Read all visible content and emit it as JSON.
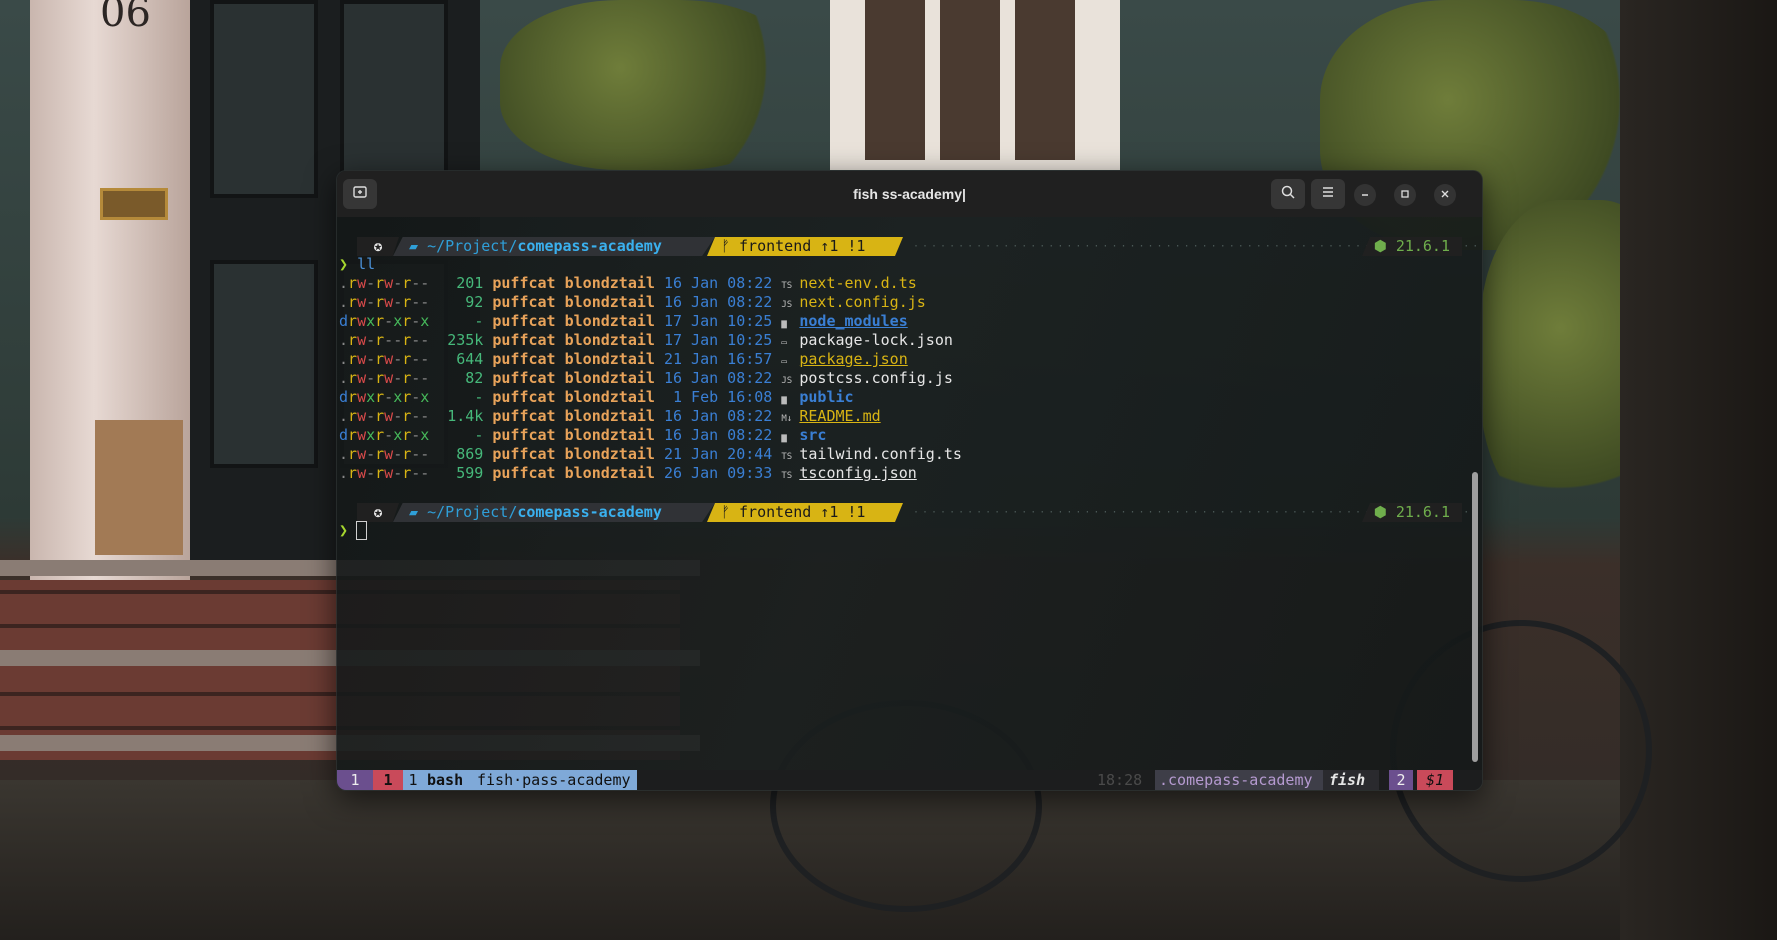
{
  "window": {
    "title": "fish ss-academy|"
  },
  "wallpaper": {
    "house_number": "06"
  },
  "prompt": {
    "path_prefix": "~/Project/",
    "path_dir": "comepass-academy",
    "git": "ᚠ frontend ↑1 !1",
    "node": "⬢ 21.6.1",
    "caret": "❯",
    "command": "ll"
  },
  "listing": [
    {
      "perm": ".rw-rw-r--",
      "size": "201",
      "owner": "puffcat",
      "group": "blondztail",
      "date": "16 Jan 08:22",
      "icon": "TS",
      "name": "next-env.d.ts",
      "style": "yellow"
    },
    {
      "perm": ".rw-rw-r--",
      "size": "92",
      "owner": "puffcat",
      "group": "blondztail",
      "date": "16 Jan 08:22",
      "icon": "JS",
      "name": "next.config.js",
      "style": "yellow"
    },
    {
      "perm": "drwxr-xr-x",
      "size": "-",
      "owner": "puffcat",
      "group": "blondztail",
      "date": "17 Jan 10:25",
      "icon": "▆",
      "name": "node_modules",
      "style": "dir-u"
    },
    {
      "perm": ".rw-r--r--",
      "size": "235k",
      "owner": "puffcat",
      "group": "blondztail",
      "date": "17 Jan 10:25",
      "icon": "▭",
      "name": "package-lock.json",
      "style": "white"
    },
    {
      "perm": ".rw-rw-r--",
      "size": "644",
      "owner": "puffcat",
      "group": "blondztail",
      "date": "21 Jan 16:57",
      "icon": "▭",
      "name": "package.json",
      "style": "yellow-u"
    },
    {
      "perm": ".rw-rw-r--",
      "size": "82",
      "owner": "puffcat",
      "group": "blondztail",
      "date": "16 Jan 08:22",
      "icon": "JS",
      "name": "postcss.config.js",
      "style": "white"
    },
    {
      "perm": "drwxr-xr-x",
      "size": "-",
      "owner": "puffcat",
      "group": "blondztail",
      "date": " 1 Feb 16:08",
      "icon": "▆",
      "name": "public",
      "style": "dir"
    },
    {
      "perm": ".rw-rw-r--",
      "size": "1.4k",
      "owner": "puffcat",
      "group": "blondztail",
      "date": "16 Jan 08:22",
      "icon": "M↓",
      "name": "README.md",
      "style": "yellow-u"
    },
    {
      "perm": "drwxr-xr-x",
      "size": "-",
      "owner": "puffcat",
      "group": "blondztail",
      "date": "16 Jan 08:22",
      "icon": "▆",
      "name": "src",
      "style": "dir"
    },
    {
      "perm": ".rw-rw-r--",
      "size": "869",
      "owner": "puffcat",
      "group": "blondztail",
      "date": "21 Jan 20:44",
      "icon": "TS",
      "name": "tailwind.config.ts",
      "style": "white"
    },
    {
      "perm": ".rw-rw-r--",
      "size": "599",
      "owner": "puffcat",
      "group": "blondztail",
      "date": "26 Jan 09:33",
      "icon": "TS",
      "name": "tsconfig.json",
      "style": "white-u"
    }
  ],
  "status_bar": {
    "session": "1",
    "window_alert": "1",
    "window_index": "1",
    "window_bash": "bash",
    "window_fish": "fish·pass-academy",
    "time": "18:28",
    "session_name": ".comepass-academy",
    "shell": "fish",
    "pane_count": "2",
    "dollar": "$1"
  },
  "colors": {
    "accent_yellow": "#d8b414",
    "path_blue": "#2f9fd8",
    "node_green": "#6fae4c",
    "status_purple": "#6b4f8e",
    "status_red": "#c94a5a",
    "status_blue": "#7fa9d8"
  }
}
